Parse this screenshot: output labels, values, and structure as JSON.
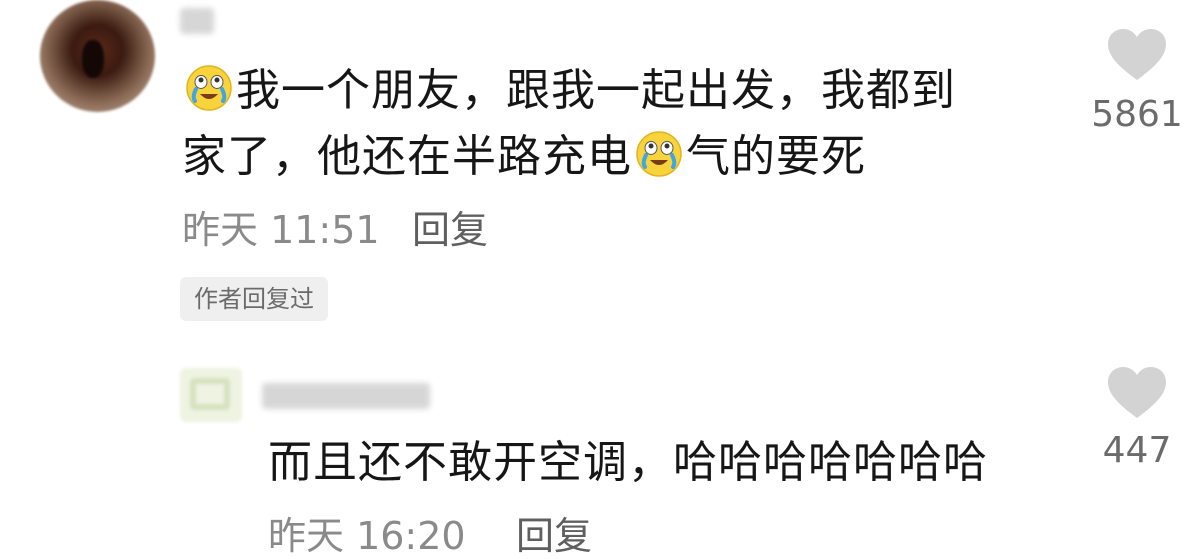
{
  "comment": {
    "text_line1_a": "我一个朋友，跟我一起出发，我都到",
    "text_line2_a": "家了，他还在半路充电",
    "text_line2_b": "气的要死",
    "emoji": "crying-laughing-emoji",
    "time": "昨天 11:51",
    "reply_label": "回复",
    "badge": "作者回复过",
    "likes": "5861"
  },
  "reply": {
    "text": "而且还不敢开空调，哈哈哈哈哈哈哈",
    "time": "昨天 16:20",
    "reply_label": "回复",
    "likes": "447"
  },
  "colors": {
    "text": "#161616",
    "meta": "#8a8a8a",
    "heart": "#d3d3d3",
    "badge_bg": "#efefef"
  },
  "icons": [
    "heart-icon",
    "crying-laughing-emoji"
  ]
}
